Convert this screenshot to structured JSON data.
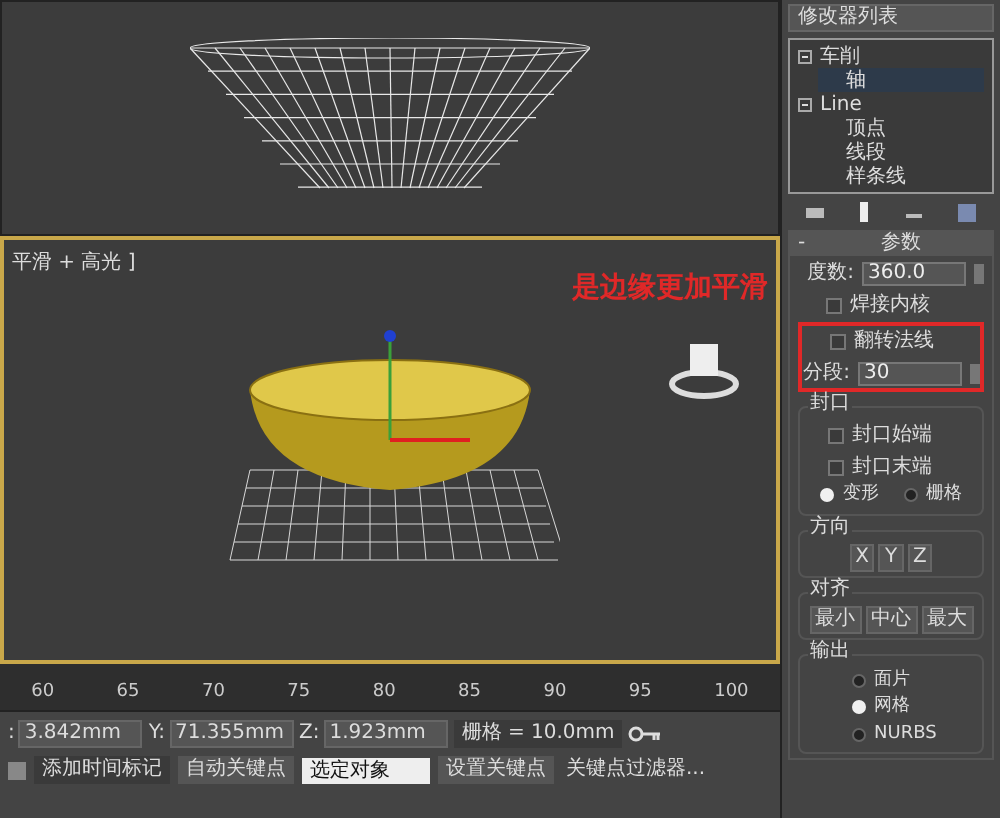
{
  "viewports": [
    {
      "kind": "wireframe",
      "active": false
    },
    {
      "kind": "shaded",
      "active": true,
      "label": "平滑 + 高光 ]",
      "annotation": "是边缘更加平滑"
    }
  ],
  "command_panel": {
    "modifier_list": "修改器列表",
    "tree": [
      {
        "label": "车削",
        "selected": false,
        "expanded": true,
        "children": [
          {
            "label": "轴",
            "selected": true
          }
        ]
      },
      {
        "label": "Line",
        "selected": false,
        "expanded": true,
        "children": [
          {
            "label": "顶点",
            "selected": false
          },
          {
            "label": "线段",
            "selected": false
          },
          {
            "label": "样条线",
            "selected": false
          }
        ]
      }
    ],
    "parameters": {
      "collapse": "-",
      "title": "参数",
      "degrees": {
        "label": "度数:",
        "value": "360.0"
      },
      "weld_core": {
        "label": "焊接内核",
        "checked": false
      },
      "flip_normals": {
        "label": "翻转法线",
        "checked": false
      },
      "segments": {
        "label": "分段:",
        "value": "30"
      },
      "highlight_box": true,
      "capping": {
        "title": "封口",
        "options": [
          {
            "label": "封口始端",
            "checked": false
          },
          {
            "label": "封口末端",
            "checked": false
          }
        ],
        "types": [
          {
            "label": "变形",
            "selected": true
          },
          {
            "label": "栅格",
            "selected": false
          }
        ]
      },
      "direction": {
        "title": "方向",
        "buttons": [
          "X",
          "Y",
          "Z"
        ]
      },
      "align": {
        "title": "对齐",
        "buttons": [
          "最小",
          "中心",
          "最大"
        ]
      },
      "output": {
        "title": "输出",
        "options": [
          {
            "label": "面片",
            "selected": false
          },
          {
            "label": "网格",
            "selected": true
          },
          {
            "label": "NURBS",
            "selected": false
          }
        ]
      }
    }
  },
  "timeline": {
    "ticks": [
      "60",
      "65",
      "70",
      "75",
      "80",
      "85",
      "90",
      "95",
      "100"
    ]
  },
  "status_bar": {
    "coords": [
      {
        "label": ":",
        "value": "3.842mm"
      },
      {
        "label": "Y:",
        "value": "71.355mm"
      },
      {
        "label": "Z:",
        "value": "1.923mm"
      }
    ],
    "grid": "栅格 = 10.0mm",
    "add_time_tag": "添加时间标记",
    "auto_key": "自动关键点",
    "set_key": "设置关键点",
    "key_filter_target": "选定对象",
    "key_filters": "关键点过滤器..."
  }
}
